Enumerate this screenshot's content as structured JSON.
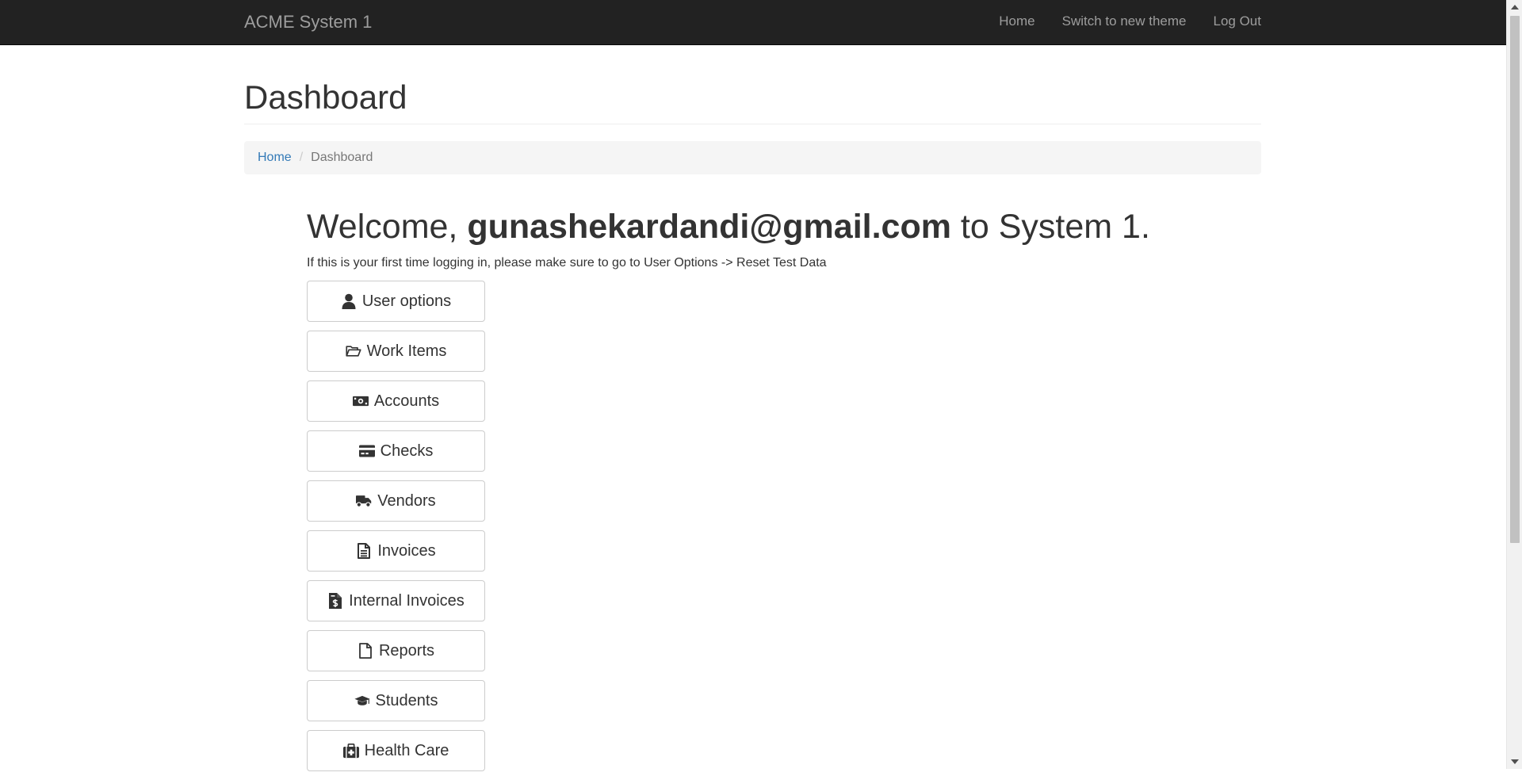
{
  "navbar": {
    "brand": "ACME System 1",
    "links": [
      {
        "label": "Home"
      },
      {
        "label": "Switch to new theme"
      },
      {
        "label": "Log Out"
      }
    ]
  },
  "page": {
    "title": "Dashboard"
  },
  "breadcrumb": {
    "home": "Home",
    "separator": "/",
    "current": "Dashboard"
  },
  "welcome": {
    "prefix": "Welcome, ",
    "user": "gunashekardandi@gmail.com",
    "suffix": " to System 1."
  },
  "notice": "If this is your first time logging in, please make sure to go to User Options -> Reset Test Data",
  "menu": [
    {
      "label": "User options",
      "icon": "user-icon"
    },
    {
      "label": "Work Items",
      "icon": "folder-open-icon"
    },
    {
      "label": "Accounts",
      "icon": "money-bill-icon"
    },
    {
      "label": "Checks",
      "icon": "credit-card-icon"
    },
    {
      "label": "Vendors",
      "icon": "truck-icon"
    },
    {
      "label": "Invoices",
      "icon": "file-text-icon"
    },
    {
      "label": "Internal Invoices",
      "icon": "file-invoice-dollar-icon"
    },
    {
      "label": "Reports",
      "icon": "file-icon"
    },
    {
      "label": "Students",
      "icon": "graduation-cap-icon"
    },
    {
      "label": "Health Care",
      "icon": "medkit-icon"
    }
  ],
  "colors": {
    "navbar_bg": "#222222",
    "navbar_text": "#9d9d9d",
    "link": "#337ab7",
    "text": "#333333",
    "breadcrumb_bg": "#f5f5f5",
    "button_border": "#cccccc"
  }
}
